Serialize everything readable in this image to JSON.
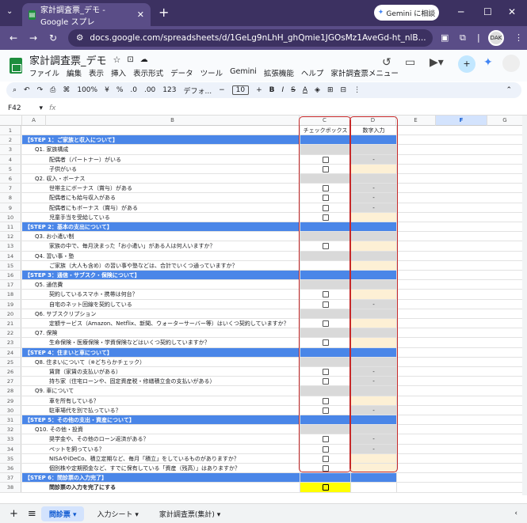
{
  "browser": {
    "tab_title": "家計調査票_デモ - Google スプレ",
    "tab_close": "✕",
    "new_tab": "+",
    "gemini_label": "Gemini に相談",
    "url": "docs.google.com/spreadsheets/d/1GeLg9nLhH_ghQmie1JGOsMz1AveGd-ht_nlB...",
    "avatar_text": "DAK"
  },
  "sheets": {
    "doc_title": "家計調査票_デモ",
    "menu": [
      "ファイル",
      "編集",
      "表示",
      "挿入",
      "表示形式",
      "データ",
      "ツール",
      "Gemini",
      "拡張機能",
      "ヘルプ",
      "家計調査票メニュー"
    ],
    "toolbar": {
      "zoom": "100%",
      "currency": "¥",
      "percent": "%",
      "dec_down": ".0",
      "dec_up": ".00",
      "num_fmt": "123",
      "font": "デフォ...",
      "font_size": "10",
      "bold": "B",
      "italic": "I",
      "strike": "S",
      "color": "A"
    },
    "name_box": "F42",
    "fx": "fx"
  },
  "columns": {
    "A": "A",
    "B": "B",
    "C": "C",
    "D": "D",
    "E": "E",
    "F": "F",
    "G": "G"
  },
  "rows": [
    {
      "n": "1",
      "text": "",
      "type": "header",
      "c": "チェックボックス",
      "d": "数字入力"
    },
    {
      "n": "2",
      "text": "【STEP 1：ご家族と収入について】",
      "type": "step"
    },
    {
      "n": "3",
      "text": "Q1. 家族構成",
      "type": "q",
      "indent": 1
    },
    {
      "n": "4",
      "text": "配偶者（パートナー）がいる",
      "indent": 2,
      "cb": true,
      "d": "-",
      "dstyle": "gray"
    },
    {
      "n": "5",
      "text": "子供がいる",
      "indent": 2,
      "cb": true,
      "dstyle": "cream"
    },
    {
      "n": "6",
      "text": "Q2. 収入・ボーナス",
      "type": "q",
      "indent": 1
    },
    {
      "n": "7",
      "text": "世帯主にボーナス（賞与）がある",
      "indent": 2,
      "cb": true,
      "d": "-",
      "dstyle": "gray"
    },
    {
      "n": "8",
      "text": "配偶者にも給与収入がある",
      "indent": 2,
      "cb": true,
      "d": "-",
      "dstyle": "gray"
    },
    {
      "n": "9",
      "text": "配偶者にもボーナス（賞与）がある",
      "indent": 2,
      "cb": true,
      "d": "-",
      "dstyle": "gray"
    },
    {
      "n": "10",
      "text": "児童手当を受給している",
      "indent": 2,
      "cb": true,
      "dstyle": "cream"
    },
    {
      "n": "11",
      "text": "【STEP 2：基本の支出について】",
      "type": "step"
    },
    {
      "n": "12",
      "text": "Q3. お小遣い制",
      "type": "q",
      "indent": 1
    },
    {
      "n": "13",
      "text": "家族の中で、毎月決まった「お小遣い」がある人は何人いますか？",
      "indent": 2,
      "cb": true,
      "dstyle": "cream"
    },
    {
      "n": "14",
      "text": "Q4. 習い事・塾",
      "type": "q",
      "indent": 1
    },
    {
      "n": "15",
      "text": "ご家族（大人も含め）の習い事や塾などは、合計でいくつ通っていますか？",
      "indent": 2,
      "dstyle": "cream"
    },
    {
      "n": "16",
      "text": "【STEP 3：通信・サブスク・保険について】",
      "type": "step"
    },
    {
      "n": "17",
      "text": "Q5. 通信費",
      "type": "q",
      "indent": 1
    },
    {
      "n": "18",
      "text": "契約しているスマホ・携帯は何台？",
      "indent": 2,
      "cb": true,
      "dstyle": "cream"
    },
    {
      "n": "19",
      "text": "自宅のネット回線を契約している",
      "indent": 2,
      "cb": true,
      "d": "-",
      "dstyle": "gray"
    },
    {
      "n": "20",
      "text": "Q6. サブスクリプション",
      "type": "q",
      "indent": 1
    },
    {
      "n": "21",
      "text": "定額サービス（Amazon、Netflix、新聞、ウォーターサーバー等）はいくつ契約していますか？",
      "indent": 2,
      "cb": true,
      "dstyle": "cream"
    },
    {
      "n": "22",
      "text": "Q7. 保険",
      "type": "q",
      "indent": 1
    },
    {
      "n": "23",
      "text": "生命保険・医療保険・学資保険などはいくつ契約していますか？",
      "indent": 2,
      "cb": true,
      "dstyle": "cream"
    },
    {
      "n": "24",
      "text": "【STEP 4：住まいと車について】",
      "type": "step"
    },
    {
      "n": "25",
      "text": "Q8. 住まいについて（※どちらかチェック）",
      "type": "q",
      "indent": 1
    },
    {
      "n": "26",
      "text": "賃貸（家賃の支払いがある）",
      "indent": 2,
      "cb": true,
      "d": "-",
      "dstyle": "gray"
    },
    {
      "n": "27",
      "text": "持ち家（住宅ローンや、固定資産税・修繕積立金の支払いがある）",
      "indent": 2,
      "cb": true,
      "d": "-",
      "dstyle": "gray"
    },
    {
      "n": "28",
      "text": "Q9. 車について",
      "type": "q",
      "indent": 1
    },
    {
      "n": "29",
      "text": "車を所有している？",
      "indent": 2,
      "cb": true,
      "dstyle": "cream"
    },
    {
      "n": "30",
      "text": "駐車場代を別で払っている？",
      "indent": 2,
      "cb": true,
      "d": "-",
      "dstyle": "gray"
    },
    {
      "n": "31",
      "text": "【STEP 5：その他の支出・資産について】",
      "type": "step"
    },
    {
      "n": "32",
      "text": "Q10. その他・投資",
      "type": "q",
      "indent": 1
    },
    {
      "n": "33",
      "text": "奨学金や、その他のローン返済がある？",
      "indent": 2,
      "cb": true,
      "d": "-",
      "dstyle": "gray"
    },
    {
      "n": "34",
      "text": "ペットを飼っている？",
      "indent": 2,
      "cb": true,
      "d": "-",
      "dstyle": "gray"
    },
    {
      "n": "35",
      "text": "NISAやiDeCo、積立定期など、毎月「積立」をしているものがありますか？",
      "indent": 2,
      "cb": true,
      "dstyle": "cream"
    },
    {
      "n": "36",
      "text": "個別株や定期預金など、すでに保有している「資産（残高）」はありますか？",
      "indent": 2,
      "cb": true,
      "dstyle": "cream"
    },
    {
      "n": "37",
      "text": "【STEP 6：問診票の入力完了】",
      "type": "step"
    },
    {
      "n": "38",
      "text": "問診票の入力を完了にする",
      "indent": 2,
      "cb": true,
      "bold": true,
      "yellow": true
    }
  ],
  "sheet_tabs": [
    "問診票",
    "入力シート",
    "家計調査票(集計)"
  ],
  "colors": {
    "step": "#4a86e8",
    "cream": "#fdf0d5",
    "gray": "#d9d9d9",
    "highlight": "#c62828",
    "yellow": "#ffff00"
  }
}
